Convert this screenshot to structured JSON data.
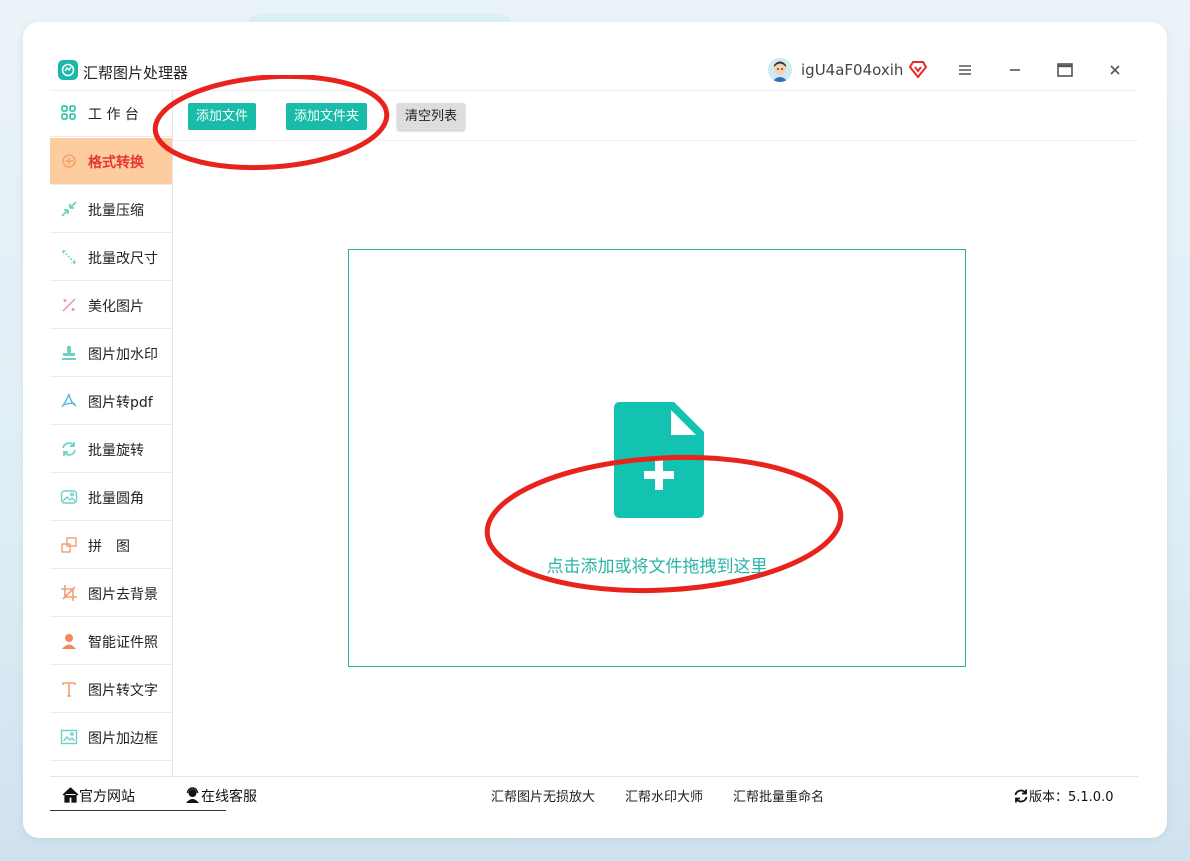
{
  "app": {
    "title": "汇帮图片处理器",
    "username": "igU4aF04oxih"
  },
  "window_controls": {
    "menu": "≡",
    "minimize": "—",
    "maximize": "▭",
    "close": "✕"
  },
  "sidebar": {
    "items": [
      {
        "label": "工 作 台",
        "icon": "grid-icon",
        "active": false
      },
      {
        "label": "格式转换",
        "icon": "convert-icon",
        "active": true
      },
      {
        "label": "批量压缩",
        "icon": "compress-icon",
        "active": false
      },
      {
        "label": "批量改尺寸",
        "icon": "resize-icon",
        "active": false
      },
      {
        "label": "美化图片",
        "icon": "beautify-icon",
        "active": false
      },
      {
        "label": "图片加水印",
        "icon": "stamp-icon",
        "active": false
      },
      {
        "label": "图片转pdf",
        "icon": "pdf-icon",
        "active": false
      },
      {
        "label": "批量旋转",
        "icon": "rotate-icon",
        "active": false
      },
      {
        "label": "批量圆角",
        "icon": "round-corner-icon",
        "active": false
      },
      {
        "label": "拼　图",
        "icon": "puzzle-icon",
        "active": false
      },
      {
        "label": "图片去背景",
        "icon": "crop-icon",
        "active": false
      },
      {
        "label": "智能证件照",
        "icon": "person-icon",
        "active": false
      },
      {
        "label": "图片转文字",
        "icon": "text-icon",
        "active": false
      },
      {
        "label": "图片加边框",
        "icon": "frame-icon",
        "active": false
      }
    ]
  },
  "toolbar": {
    "add_file": "添加文件",
    "add_folder": "添加文件夹",
    "clear_list": "清空列表"
  },
  "dropzone": {
    "hint": "点击添加或将文件拖拽到这里"
  },
  "footer": {
    "website": "官方网站",
    "support": "在线客服",
    "links": [
      "汇帮图片无损放大",
      "汇帮水印大师",
      "汇帮批量重命名"
    ],
    "version": "版本：5.1.0.0"
  },
  "colors": {
    "accent": "#19bca8",
    "active_bg": "#fdcda0",
    "active_text": "#e8382c",
    "annotation": "#e8231c"
  }
}
